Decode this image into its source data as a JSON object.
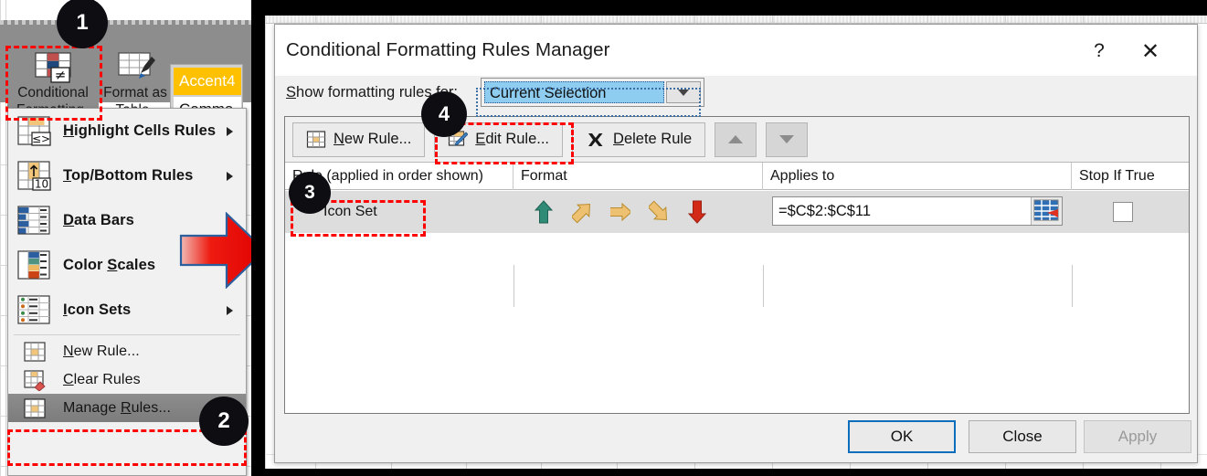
{
  "ribbon": {
    "conditional_formatting": {
      "line1": "Conditional",
      "line2": "Formatting",
      "caret": "▾",
      "icon": "conditional-formatting-icon"
    },
    "format_as_table": {
      "line1": "Format as",
      "line2": "Table",
      "caret": "▾",
      "icon": "format-as-table-icon"
    },
    "cell_styles": [
      {
        "label": "Accent4",
        "bg": "#ffc000",
        "fg": "#ffffff"
      },
      {
        "label": "Comma",
        "bg": "#ffffff",
        "fg": "#111111"
      }
    ]
  },
  "cf_menu": {
    "items": [
      {
        "label": "Highlight Cells Rules",
        "underline": "H",
        "submenu": true,
        "icon": "highlight-cells-rules-icon"
      },
      {
        "label": "Top/Bottom Rules",
        "underline": "T",
        "submenu": true,
        "icon": "top-bottom-rules-icon"
      },
      {
        "label": "Data Bars",
        "underline": "D",
        "submenu": true,
        "icon": "data-bars-icon"
      },
      {
        "label": "Color Scales",
        "underline": "S",
        "submenu": true,
        "icon": "color-scales-icon"
      },
      {
        "label": "Icon Sets",
        "underline": "I",
        "submenu": true,
        "icon": "icon-sets-icon"
      }
    ],
    "commands": [
      {
        "label": "New Rule...",
        "underline": "N",
        "icon": "new-rule-icon"
      },
      {
        "label": "Clear Rules",
        "underline": "C",
        "submenu": true,
        "icon": "clear-rules-icon"
      },
      {
        "label": "Manage Rules...",
        "underline": "R",
        "icon": "manage-rules-icon",
        "highlighted": true
      }
    ]
  },
  "dialog": {
    "title": "Conditional Formatting Rules Manager",
    "help_glyph": "?",
    "close_glyph": "✕",
    "show_rules_label": "Show formatting rules for:",
    "show_rules_value": "Current Selection",
    "toolbar": {
      "new_rule": "New Rule...",
      "edit_rule": "Edit Rule...",
      "delete_rule": "Delete Rule",
      "move_up": "move-up",
      "move_down": "move-down"
    },
    "columns": [
      "Rule (applied in order shown)",
      "Format",
      "Applies to",
      "Stop If True"
    ],
    "rows": [
      {
        "rule": "Icon Set",
        "format_icons": [
          {
            "name": "arrow-up-green",
            "color": "#2f8a76",
            "dir": "up"
          },
          {
            "name": "arrow-up-right-yellow",
            "color": "#e8b84b",
            "dir": "up-right"
          },
          {
            "name": "arrow-right-yellow",
            "color": "#e8b84b",
            "dir": "right"
          },
          {
            "name": "arrow-down-right-yellow",
            "color": "#e8b84b",
            "dir": "down-right"
          },
          {
            "name": "arrow-down-red",
            "color": "#d32a18",
            "dir": "down"
          }
        ],
        "applies_to": "=$C$2:$C$11",
        "stop_if_true": false
      }
    ],
    "footer": {
      "ok": "OK",
      "close": "Close",
      "apply": "Apply"
    }
  },
  "badges": [
    {
      "label": "1"
    },
    {
      "label": "2"
    },
    {
      "label": "3"
    },
    {
      "label": "4"
    }
  ],
  "colors": {
    "accent_yellow": "#ffc000",
    "highlight_blue": "#8ecdf0",
    "annotation_red": "#ff0000",
    "focus_blue": "#0a6ebd"
  }
}
